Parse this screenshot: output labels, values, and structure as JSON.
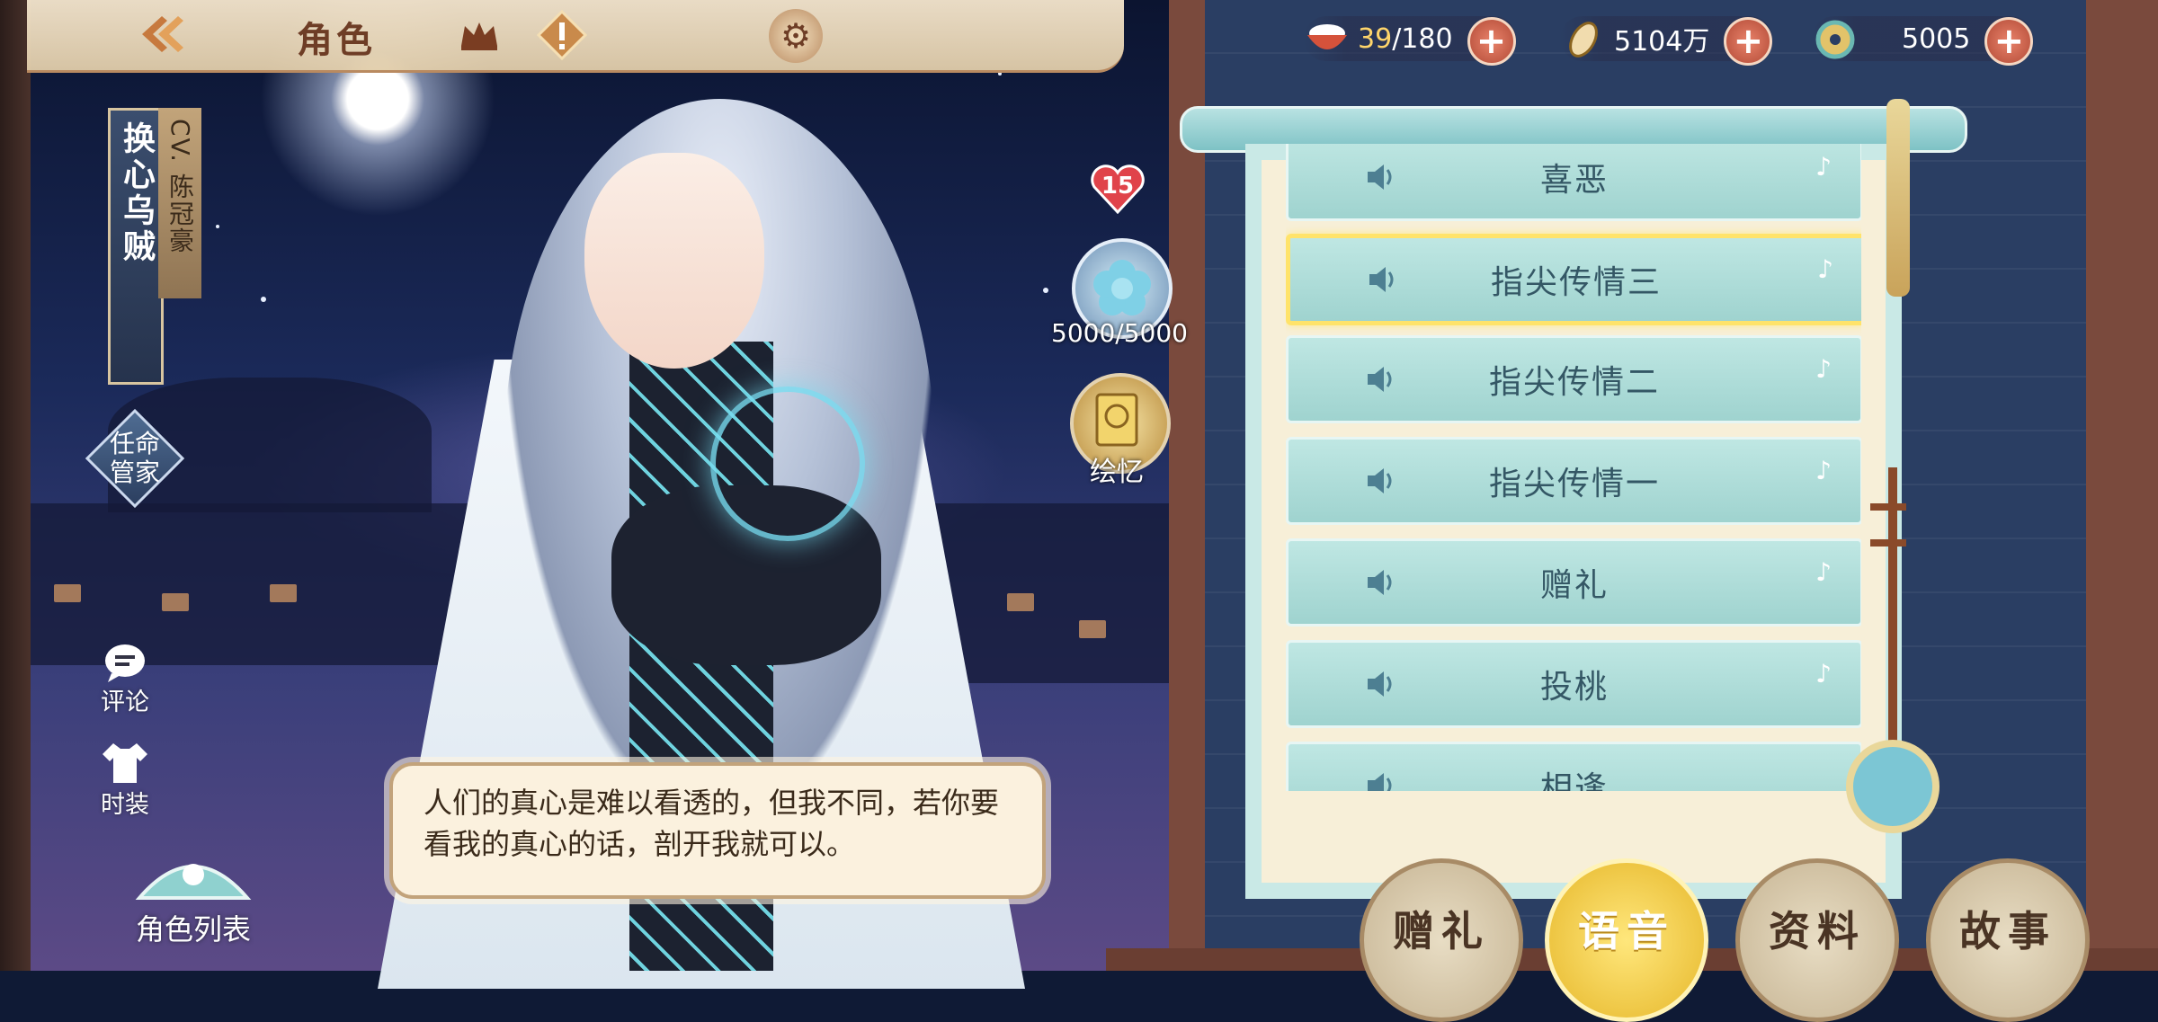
{
  "header": {
    "title": "角色",
    "back_icon": "back-arrow-icon",
    "crown_icon": "crown-icon",
    "alert_icon": "exclamation-icon",
    "settings_icon": "gear-icon"
  },
  "character": {
    "name": "换心乌贼",
    "cv": "CV. 陈冠豪",
    "affection_level": "15",
    "flower_value": "5000/5000",
    "memory_label": "绘忆"
  },
  "left_menu": {
    "appoint": "任命管家",
    "comment": "评论",
    "fashion": "时装",
    "role_list": "角色列表"
  },
  "currency": [
    {
      "name": "stamina",
      "icon": "rice-bowl-icon",
      "current": "39",
      "max": "/180"
    },
    {
      "name": "coins",
      "icon": "coin-icon",
      "current": "5104万",
      "max": ""
    },
    {
      "name": "jade",
      "icon": "jade-icon",
      "current": "5005",
      "max": ""
    }
  ],
  "voice_list": {
    "items": [
      "喜恶",
      "指尖传情三",
      "指尖传情二",
      "指尖传情一",
      "赠礼",
      "投桃",
      "相逢"
    ],
    "selected": 1
  },
  "dialogue": {
    "text": "人们的真心是难以看透的，但我不同，若你要看我的真心的话，剖开我就可以。"
  },
  "tabs": [
    "赠礼",
    "语音",
    "资料",
    "故事"
  ],
  "active_tab": 1,
  "colors": {
    "accent": "#e6b72a",
    "scroll_item": "#9fd3cf",
    "frame": "#8a4a3a"
  }
}
